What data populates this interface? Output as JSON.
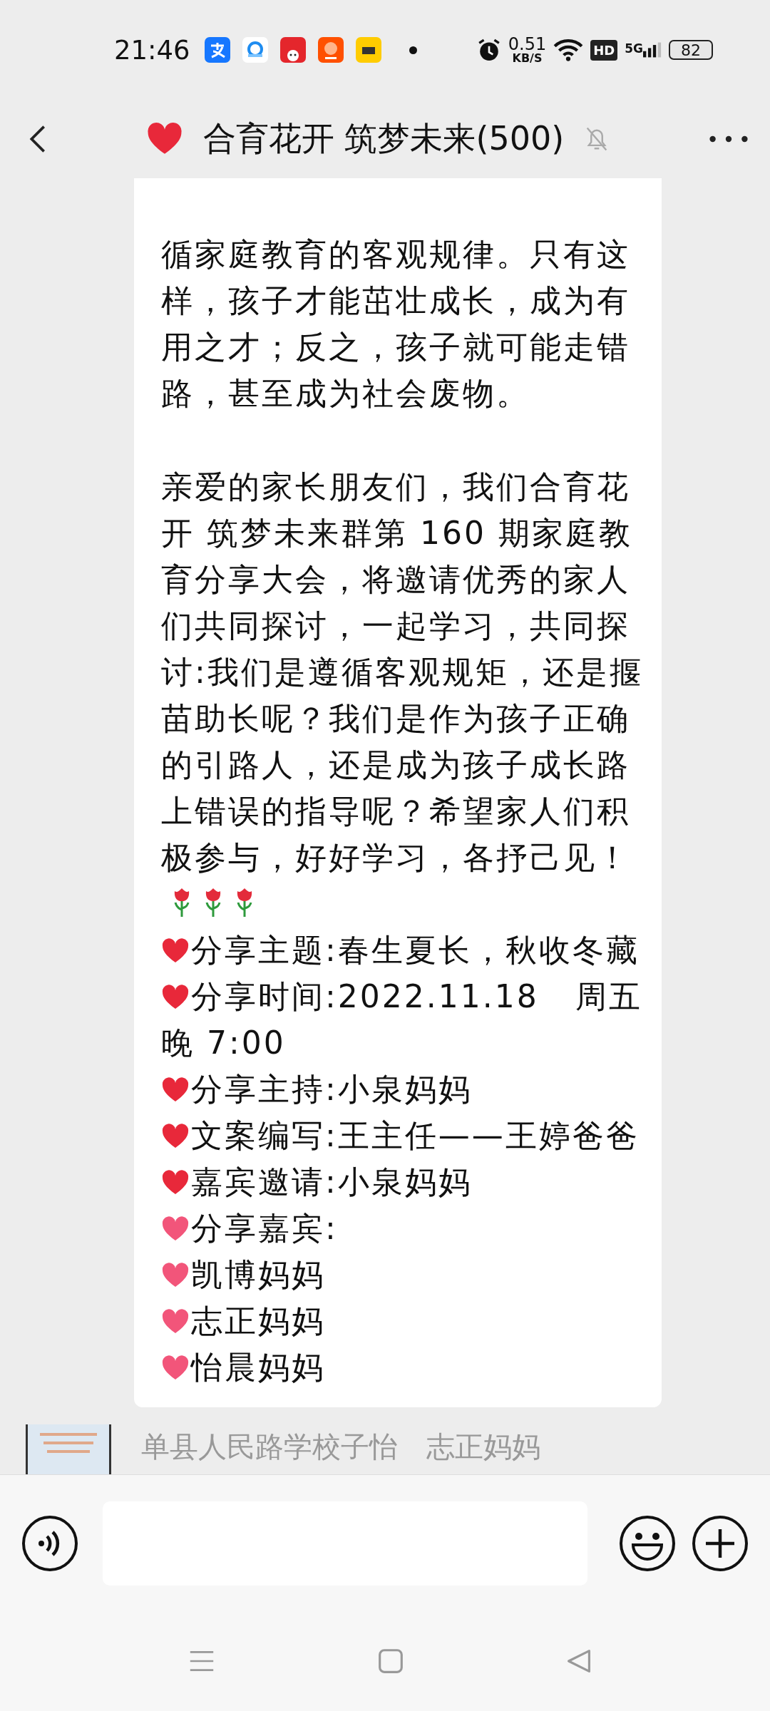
{
  "status_bar": {
    "time": "21:46",
    "speed_value": "0.51",
    "speed_unit": "KB/S",
    "hd": "HD",
    "network": "5G",
    "battery": "82"
  },
  "header": {
    "title": "合育花开 筑梦未来(500)"
  },
  "message": {
    "blocks": [
      {
        "kind": "paragraph",
        "text": "循家庭教育的客观规律。只有这样，孩子才能茁壮成长，成为有用之才；反之，孩子就可能走错路，甚至成为社会废物。"
      },
      {
        "kind": "closing_paragraph",
        "text": "亲爱的家长朋友们，我们合育花开  筑梦未来群第 160 期家庭教育分享大会，将邀请优秀的家人们共同探讨，一起学习，共同探讨:我们是遵循客观规矩，还是揠苗助长呢？我们是作为孩子正确的引路人，还是成为孩子成长路上错误的指导呢？希望家人们积极参与，好好学习，各抒己见！"
      },
      {
        "kind": "item",
        "color": "#e8283a",
        "text": "分享主题:春生夏长，秋收冬藏"
      },
      {
        "kind": "item",
        "color": "#e8283a",
        "text": "分享时间:2022.11.18   周五晚 7:00"
      },
      {
        "kind": "item",
        "color": "#e8283a",
        "text": "分享主持:小泉妈妈"
      },
      {
        "kind": "item",
        "color": "#e8283a",
        "text": "文案编写:王主任——王婷爸爸"
      },
      {
        "kind": "item",
        "color": "#e8283a",
        "text": "嘉宾邀请:小泉妈妈"
      },
      {
        "kind": "item",
        "color": "#f2557a",
        "text": "分享嘉宾:"
      },
      {
        "kind": "item",
        "color": "#f2557a",
        "text": "凯博妈妈"
      },
      {
        "kind": "item",
        "color": "#f2557a",
        "text": "志正妈妈"
      },
      {
        "kind": "item",
        "color": "#f2557a",
        "text": "怡晨妈妈"
      }
    ]
  },
  "next_message": {
    "kind": "picture",
    "sender": "单县人民路学校子怡　志正妈妈"
  }
}
